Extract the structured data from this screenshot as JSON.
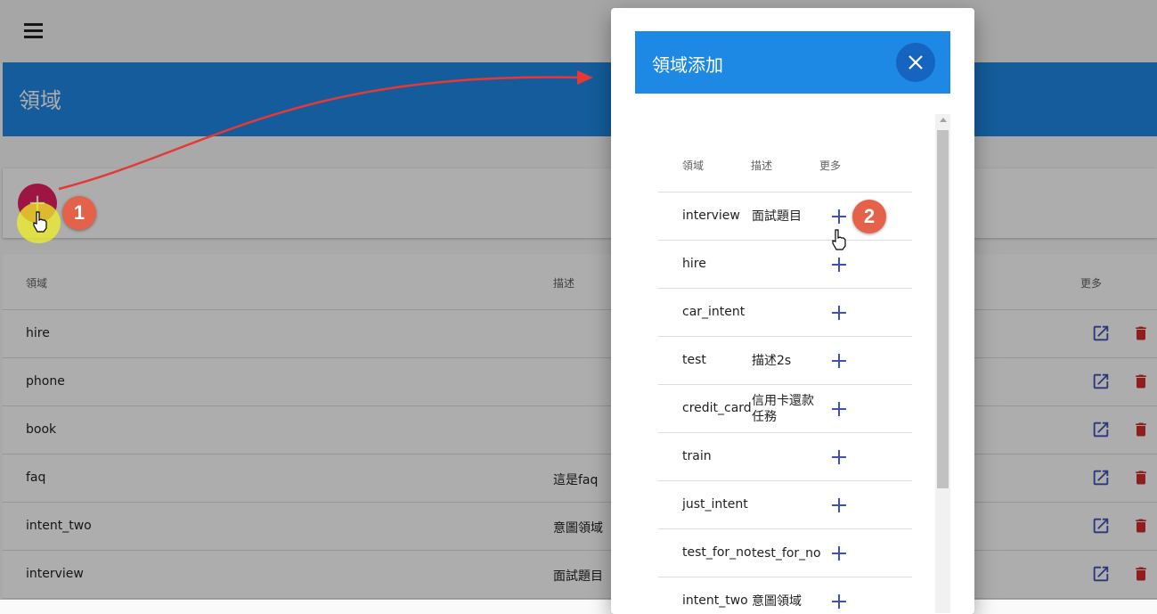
{
  "app": {
    "page_title": "領域",
    "add_icon_glyph": "+"
  },
  "main_table": {
    "headers": {
      "domain": "領域",
      "description": "描述",
      "more": "更多"
    },
    "rows": [
      {
        "domain": "hire",
        "description": ""
      },
      {
        "domain": "phone",
        "description": ""
      },
      {
        "domain": "book",
        "description": ""
      },
      {
        "domain": "faq",
        "description": "這是faq"
      },
      {
        "domain": "intent_two",
        "description": "意圖領域"
      },
      {
        "domain": "interview",
        "description": "面試題目"
      }
    ],
    "edit_icon": "open-in-new-icon",
    "delete_icon": "trash-icon",
    "edit_color": "#3f51b5",
    "delete_color": "#d32f2f"
  },
  "dialog": {
    "title": "領域添加",
    "close_glyph": "✕",
    "headers": {
      "domain": "領域",
      "description": "描述",
      "more": "更多"
    },
    "rows": [
      {
        "domain": "interview",
        "description": "面試題目"
      },
      {
        "domain": "hire",
        "description": ""
      },
      {
        "domain": "car_intent",
        "description": ""
      },
      {
        "domain": "test",
        "description": "描述2s"
      },
      {
        "domain": "credit_card",
        "description": "信用卡還款任務"
      },
      {
        "domain": "train",
        "description": ""
      },
      {
        "domain": "just_intent",
        "description": ""
      },
      {
        "domain": "test_for_no",
        "description": "test_for_no"
      },
      {
        "domain": "intent_two",
        "description": "意圖領域"
      }
    ],
    "add_color": "#3f51b5"
  },
  "annotations": {
    "step1": "1",
    "step2": "2",
    "arrow_color": "#e53935"
  },
  "colors": {
    "primary": "#1e88e5",
    "primary_dark": "#1565c0",
    "fab": "#e91e63",
    "step_badge": "#e5624a"
  }
}
